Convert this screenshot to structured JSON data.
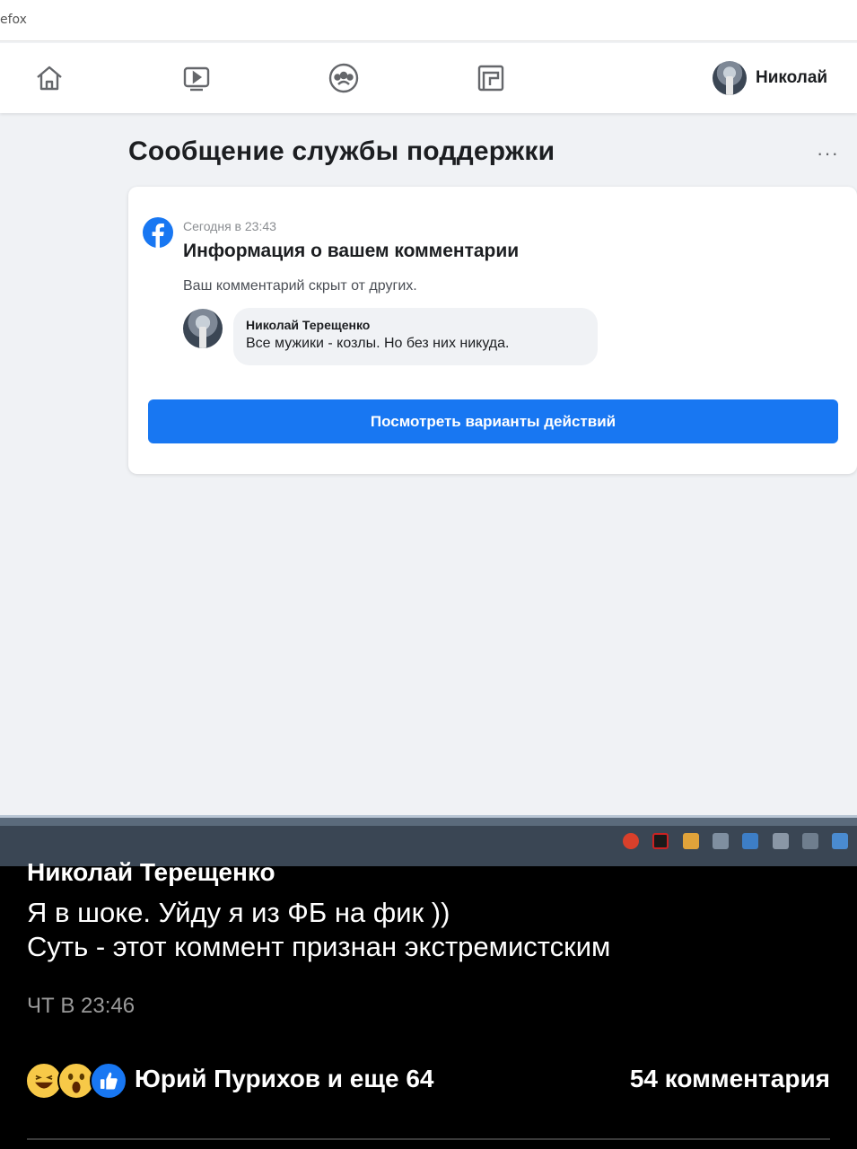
{
  "browser": {
    "title_fragment": "efox"
  },
  "navbar": {
    "icons": [
      "home-icon",
      "watch-icon",
      "groups-icon",
      "gaming-icon"
    ],
    "profile_name": "Николай"
  },
  "page": {
    "title": "Сообщение службы поддержки",
    "more_label": "···"
  },
  "message": {
    "time": "Сегодня в 23:43",
    "title": "Информация о вашем комментарии",
    "text": "Ваш комментарий скрыт от других.",
    "comment": {
      "author": "Николай Терещенко",
      "text": "Все мужики - козлы. Но без них никуда."
    },
    "button_label": "Посмотреть варианты действий"
  },
  "post": {
    "author": "Николай Терещенко",
    "line1": "Я в шоке. Уйду я из ФБ на фик ))",
    "line2": "Суть - этот коммент признан экстремистским",
    "time": "ЧТ В 23:46",
    "reactions": [
      "laugh-reaction",
      "wow-reaction",
      "like-reaction"
    ],
    "reactors": "Юрий Пурихов и еще 64",
    "comments": "54 комментария"
  },
  "colors": {
    "facebook_blue": "#1877f2",
    "page_background": "#f0f2f5",
    "post_background": "#000000"
  }
}
